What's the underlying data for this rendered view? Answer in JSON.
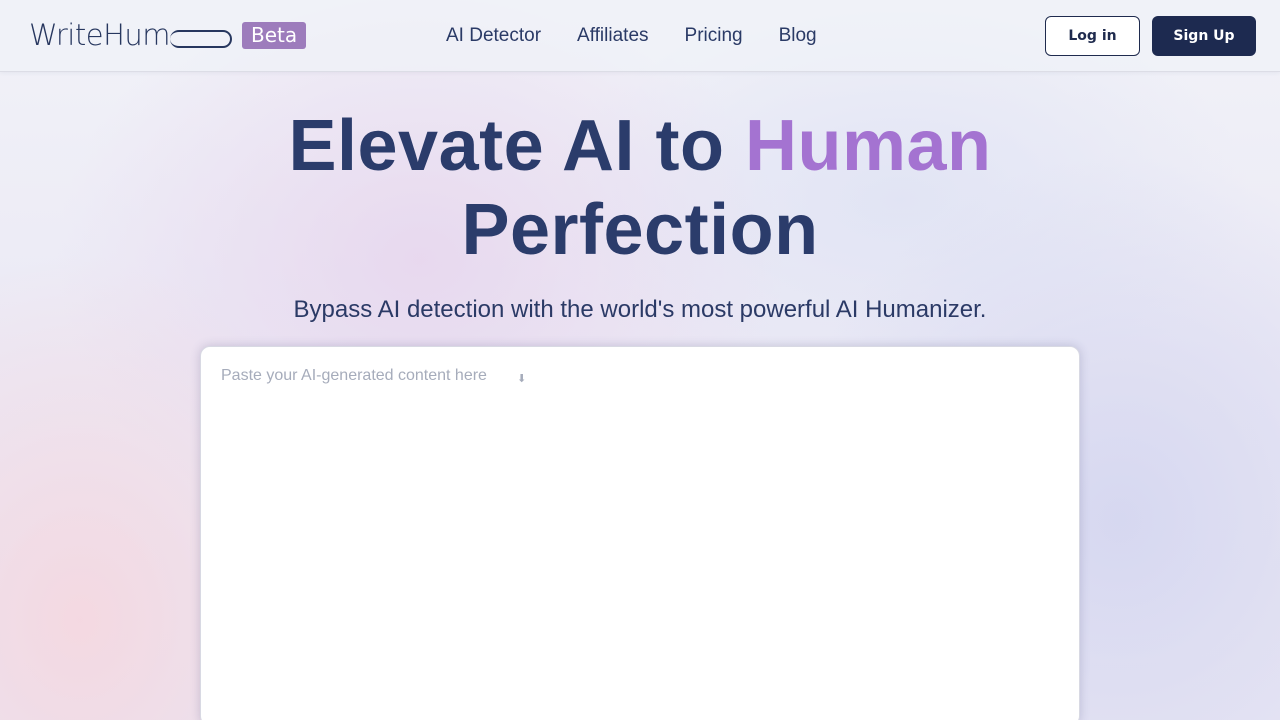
{
  "header": {
    "logo_text": "WriteHum",
    "beta_badge": "Beta",
    "nav": [
      {
        "label": "AI Detector"
      },
      {
        "label": "Affiliates"
      },
      {
        "label": "Pricing"
      },
      {
        "label": "Blog"
      }
    ],
    "login_label": "Log in",
    "signup_label": "Sign Up"
  },
  "hero": {
    "title_part1": "Elevate AI to ",
    "title_accent": "Human",
    "title_part2": "Perfection",
    "subtitle": "Bypass AI detection with the world's most powerful AI Humanizer."
  },
  "editor": {
    "placeholder": "Paste your AI-generated content here",
    "placeholder_icon": "⬇",
    "value": ""
  },
  "colors": {
    "brand_navy": "#1d2a50",
    "title_navy": "#2b3c6b",
    "accent_purple": "#a473d1",
    "beta_purple": "#9d7cbc"
  }
}
